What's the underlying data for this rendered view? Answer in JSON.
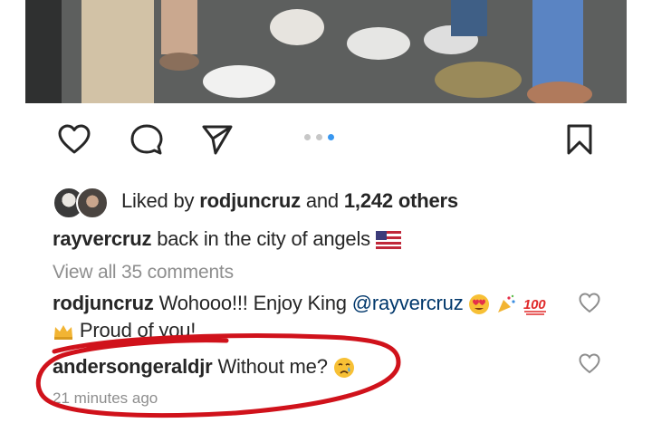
{
  "post": {
    "likes": {
      "prefix": "Liked by",
      "user": "rodjuncruz",
      "joiner": "and",
      "others": "1,242 others"
    },
    "caption": {
      "user": "rayvercruz",
      "text": "back in the city of angels",
      "flag_icon": "us-flag-icon"
    },
    "view_comments": "View all 35 comments",
    "comments": [
      {
        "user": "rodjuncruz",
        "text": "Wohooo!!! Enjoy King",
        "mention": "@rayvercruz",
        "text2": "Proud of you!",
        "emojis": [
          "heart-eyes-icon",
          "party-popper-icon",
          "hundred-points-icon",
          "crown-icon"
        ]
      },
      {
        "user": "andersongeraldjr",
        "text": "Without me?",
        "emoji": "crying-face-icon"
      }
    ],
    "timestamp": "21 minutes ago",
    "carousel": {
      "count": 3,
      "active_index": 2
    }
  },
  "colors": {
    "text": "#262626",
    "muted": "#8e8e8e",
    "accent": "#3897f0",
    "annotation": "#d0121b"
  }
}
